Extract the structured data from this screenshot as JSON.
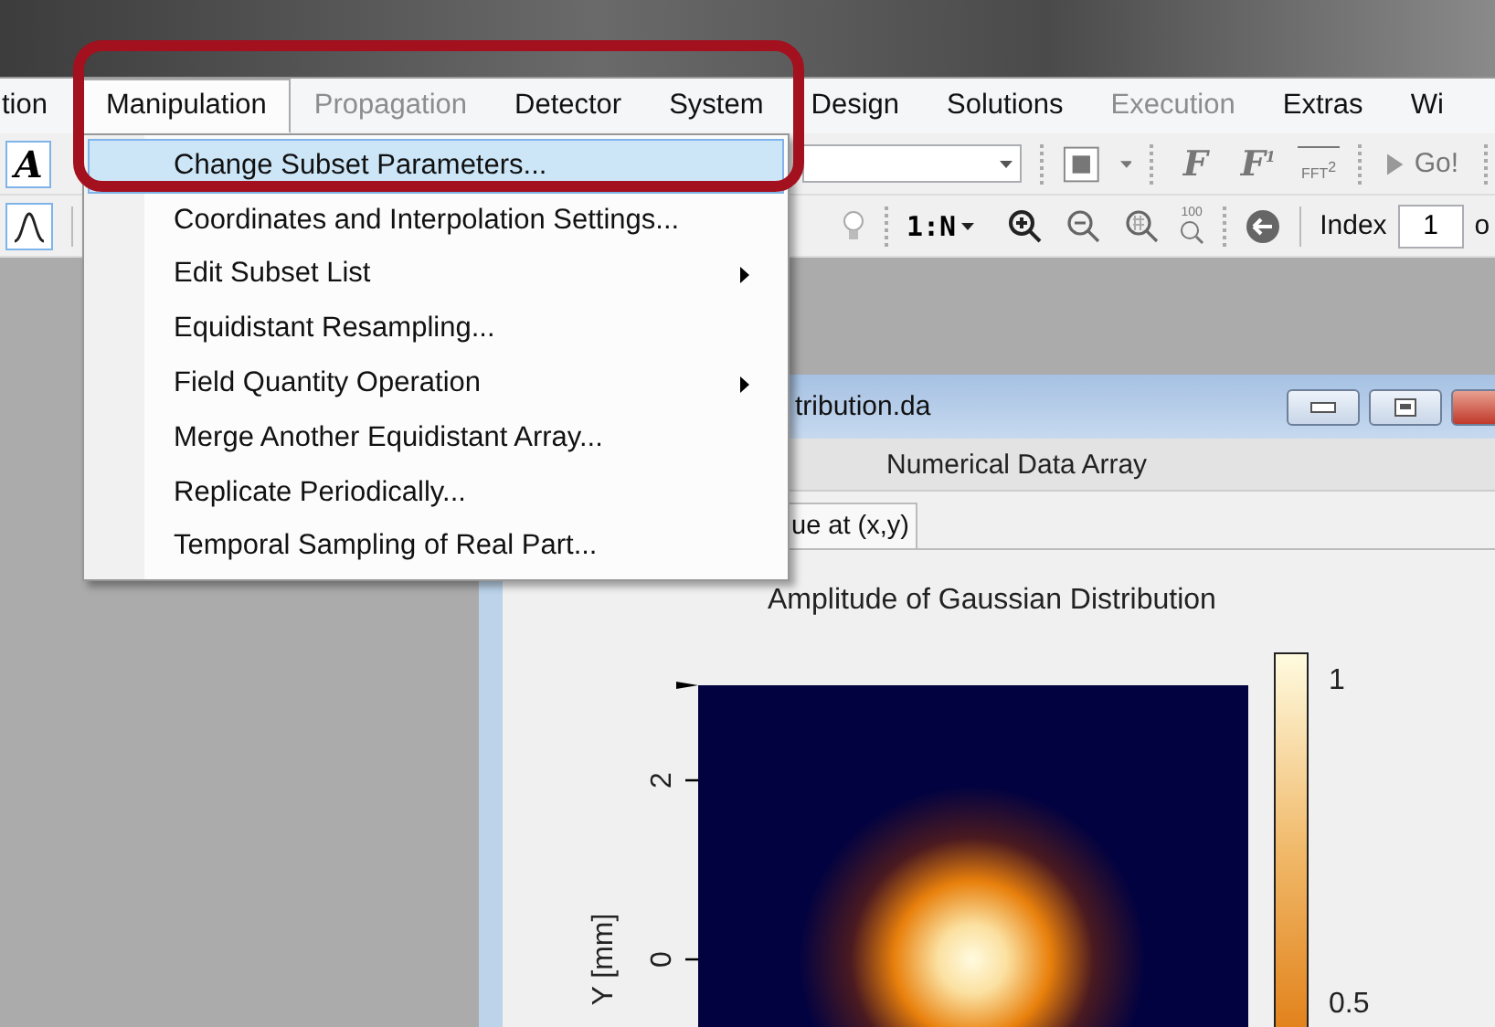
{
  "menu_bar": [
    {
      "label": "tion",
      "selected": false,
      "disabled": false
    },
    {
      "label": "Manipulation",
      "selected": true,
      "disabled": false
    },
    {
      "label": "Propagation",
      "selected": false,
      "disabled": true
    },
    {
      "label": "Detector",
      "selected": false,
      "disabled": false
    },
    {
      "label": "System",
      "selected": false,
      "disabled": false
    },
    {
      "label": "Design",
      "selected": false,
      "disabled": false
    },
    {
      "label": "Solutions",
      "selected": false,
      "disabled": false
    },
    {
      "label": "Execution",
      "selected": false,
      "disabled": true
    },
    {
      "label": "Extras",
      "selected": false,
      "disabled": false
    },
    {
      "label": "Wi",
      "selected": false,
      "disabled": false
    }
  ],
  "dropdown": [
    {
      "label": "Change Subset Parameters...",
      "selected": true,
      "submenu": false
    },
    {
      "label": "Coordinates and Interpolation Settings...",
      "selected": false,
      "submenu": false
    },
    {
      "label": "Edit Subset List",
      "selected": false,
      "submenu": true
    },
    {
      "label": "Equidistant Resampling...",
      "selected": false,
      "submenu": false
    },
    {
      "label": "Field Quantity Operation",
      "selected": false,
      "submenu": true
    },
    {
      "label": "Merge Another Equidistant Array...",
      "selected": false,
      "submenu": false
    },
    {
      "label": "Replicate Periodically...",
      "selected": false,
      "submenu": false
    },
    {
      "label": "Temporal Sampling of Real Part...",
      "selected": false,
      "submenu": false
    }
  ],
  "toolbar_1": {
    "text_tool": "A",
    "fourier_buttons": [
      {
        "label": "F"
      },
      {
        "label": "F",
        "exponent": "1"
      }
    ],
    "fft_button": {
      "label": "FFT",
      "exponent": "2"
    },
    "go_button": "Go!"
  },
  "toolbar_2": {
    "one_to_n": "1:N",
    "zoom_100_label": "100",
    "index_label": "Index",
    "index_value": "1",
    "of_label": "o"
  },
  "document_window": {
    "title": "tribution.da",
    "header": "Numerical Data Array",
    "tabs": [
      {
        "label": "ue at (x,y)",
        "selected": true
      }
    ],
    "chart": {
      "title": "Amplitude of Gaussian Distribution",
      "y_label": "Y [mm]",
      "y_ticks": [
        "2",
        "0"
      ],
      "colorbar_ticks": [
        "1",
        "0.5"
      ]
    }
  }
}
